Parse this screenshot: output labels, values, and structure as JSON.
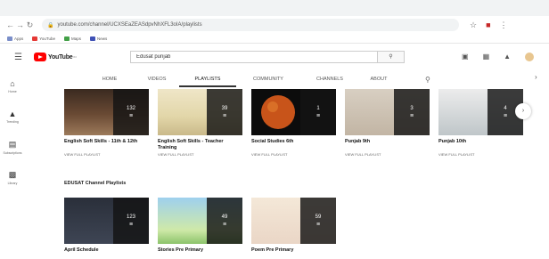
{
  "browser": {
    "url": "youtube.com/channel/UCXSEaZEASdpvNhXFL3oIA/playlists",
    "bookmarks": [
      {
        "label": "Apps",
        "icon": "apps-icon"
      },
      {
        "label": "YouTube",
        "icon": "youtube-favicon-icon"
      },
      {
        "label": "Maps",
        "icon": "maps-icon"
      },
      {
        "label": "News",
        "icon": "news-icon"
      }
    ]
  },
  "youtube": {
    "logo_text": "YouTube",
    "logo_country": "IN",
    "search_value": "Edusat punjab"
  },
  "guide": [
    {
      "label": "Home",
      "icon": "home-icon"
    },
    {
      "label": "Trending",
      "icon": "trending-icon"
    },
    {
      "label": "Subscriptions",
      "icon": "subscriptions-icon"
    },
    {
      "label": "Library",
      "icon": "library-icon"
    }
  ],
  "tabs": [
    {
      "label": "HOME",
      "active": false
    },
    {
      "label": "VIDEOS",
      "active": false
    },
    {
      "label": "PLAYLISTS",
      "active": true
    },
    {
      "label": "COMMUNITY",
      "active": false
    },
    {
      "label": "CHANNELS",
      "active": false
    },
    {
      "label": "ABOUT",
      "active": false
    }
  ],
  "view_full_label": "VIEW FULL PLAYLIST",
  "playlists_row1": [
    {
      "title": "English Soft Skills - 11th & 12th",
      "count": "132"
    },
    {
      "title": "English Soft Skills - Teacher Training",
      "count": "39"
    },
    {
      "title": "Social Studies 6th",
      "count": "1"
    },
    {
      "title": "Punjab 9th",
      "count": "3"
    },
    {
      "title": "Punjab 10th",
      "count": "4"
    }
  ],
  "section2_title": "EDUSAT Channel Playlists",
  "playlists_row2": [
    {
      "title": "April Schedule",
      "count": "123"
    },
    {
      "title": "Stories Pre Primary",
      "count": "49"
    },
    {
      "title": "Poem Pre Primary",
      "count": "59"
    }
  ],
  "colors": {
    "brand_red": "#ff0000",
    "overlay": "#141414",
    "tab_active": "#333333"
  }
}
